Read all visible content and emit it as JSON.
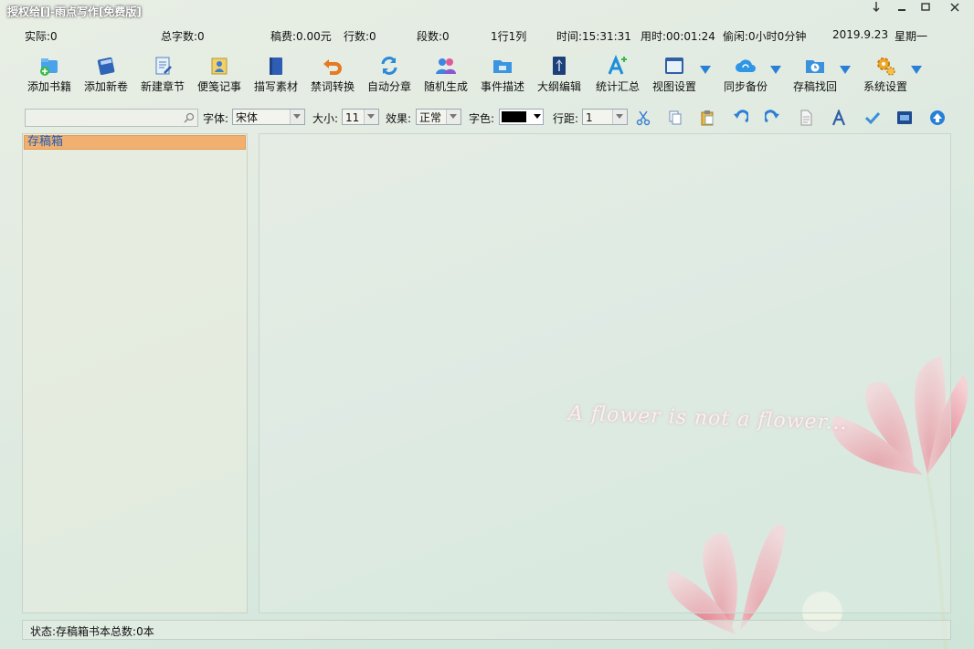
{
  "window": {
    "title": "授权给[]-雨点写作[免费版]",
    "controls": [
      "pin",
      "minimize",
      "maximize",
      "close"
    ]
  },
  "stats": {
    "actual": "实际:0",
    "total_words": "总字数:0",
    "fee": "稿费:0.00元",
    "lines": "行数:0",
    "paragraphs": "段数:0",
    "cursor": "1行1列",
    "time": "时间:15:31:31",
    "used_time": "用时:00:01:24",
    "idle": "偷闲:0小时0分钟",
    "date": "2019.9.23",
    "weekday": "星期一"
  },
  "toolbar": {
    "items": [
      {
        "label": "添加书籍",
        "icon": "add-book-icon"
      },
      {
        "label": "添加新卷",
        "icon": "add-volume-icon"
      },
      {
        "label": "新建章节",
        "icon": "new-chapter-icon"
      },
      {
        "label": "便笺记事",
        "icon": "note-icon"
      },
      {
        "label": "描写素材",
        "icon": "material-book-icon"
      },
      {
        "label": "禁词转换",
        "icon": "undo-arrow-icon"
      },
      {
        "label": "自动分章",
        "icon": "refresh-icon"
      },
      {
        "label": "随机生成",
        "icon": "users-icon"
      },
      {
        "label": "事件描述",
        "icon": "folder-icon"
      },
      {
        "label": "大纲编辑",
        "icon": "outline-book-icon"
      },
      {
        "label": "统计汇总",
        "icon": "stats-a-plus-icon"
      },
      {
        "label": "视图设置",
        "icon": "window-view-icon"
      },
      {
        "label": "同步备份",
        "icon": "cloud-sync-icon"
      },
      {
        "label": "存稿找回",
        "icon": "clock-folder-icon"
      },
      {
        "label": "系统设置",
        "icon": "gears-icon"
      }
    ]
  },
  "format": {
    "search_placeholder": "",
    "font_label": "字体:",
    "font_value": "宋体",
    "size_label": "大小:",
    "size_value": "11",
    "effect_label": "效果:",
    "effect_value": "正常",
    "color_label": "字色:",
    "color_value": "#000000",
    "spacing_label": "行距:",
    "spacing_value": "1",
    "icons": [
      "cut-icon",
      "copy-icon",
      "paste-icon",
      "undo-icon",
      "redo-icon",
      "document-icon",
      "font-a-icon",
      "check-icon",
      "export-icon",
      "up-arrow-icon"
    ]
  },
  "sidebar": {
    "items": [
      {
        "label": "存稿箱"
      }
    ]
  },
  "editor": {
    "caption": "A flower is not a flower..."
  },
  "status": {
    "text": "状态:存稿箱书本总数:0本"
  },
  "colors": {
    "accent_blue": "#2a7fd6",
    "selected_item": "#f2b070",
    "flower_pink": "#f0a2ae"
  }
}
